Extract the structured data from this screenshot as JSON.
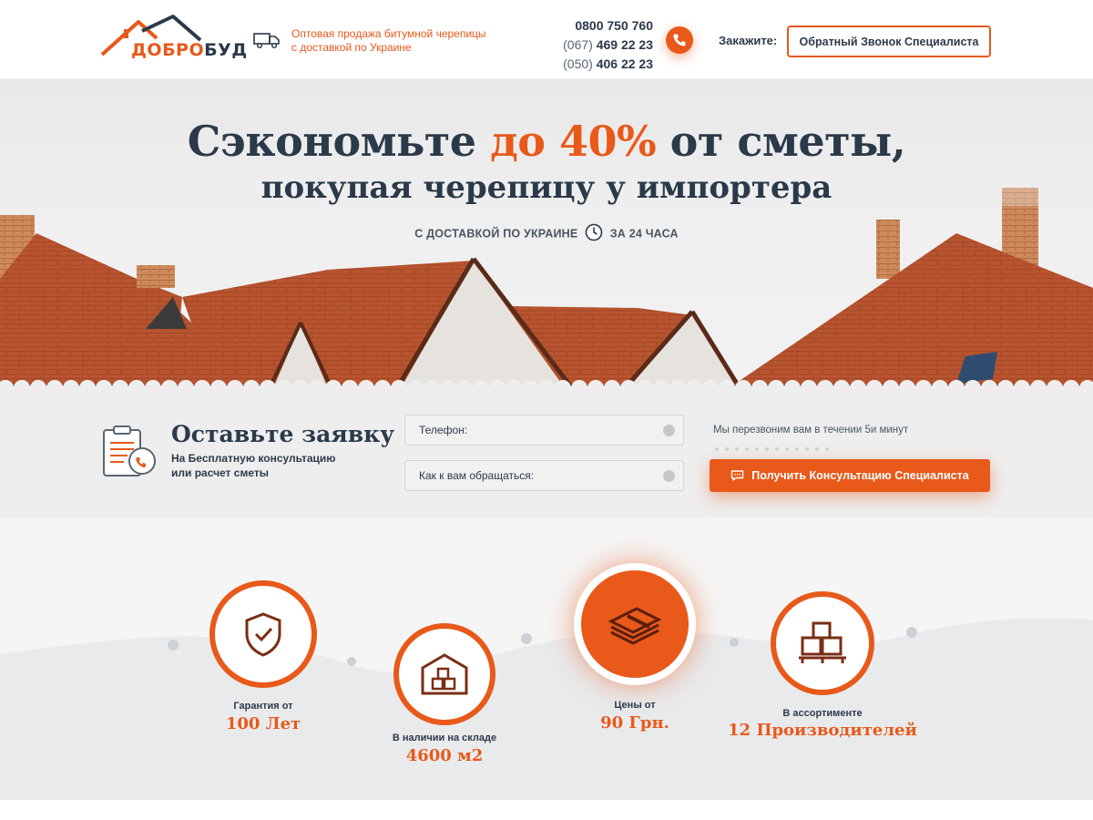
{
  "header": {
    "logo": {
      "part1": "ДОБРО",
      "part2": "БУД"
    },
    "tagline_line1": "Оптовая продажа битумной черепицы",
    "tagline_line2": "с доставкой по Украине",
    "phones": [
      {
        "code": "",
        "number": "0800 750 760"
      },
      {
        "code": "(067)",
        "number": "469 22 23"
      },
      {
        "code": "(050)",
        "number": "406 22 23"
      }
    ],
    "order_label": "Закажите:",
    "callback_button": "Обратный Звонок Специалиста"
  },
  "hero": {
    "title_pre": "Сэкономьте ",
    "title_accent": "до 40%",
    "title_post": " от сметы,",
    "subtitle": "покупая черепицу у импортера",
    "delivery_left": "С ДОСТАВКОЙ ПО УКРАИНЕ",
    "delivery_right": "ЗА 24 ЧАСА"
  },
  "form": {
    "title": "Оставьте заявку",
    "desc_line1": "На Бесплатную консультацию",
    "desc_line2": "или расчет сметы",
    "phone_placeholder": "Телефон:",
    "name_placeholder": "Как к вам обращаться:",
    "callback_note": "Мы перезвоним вам в течении 5и минут",
    "submit_label": "Получить Консультацию Специалиста"
  },
  "features": [
    {
      "label": "Гарантия от",
      "value": "100 Лет",
      "icon": "shield-check-icon"
    },
    {
      "label": "В наличии на складе",
      "value": "4600 м2",
      "icon": "warehouse-icon"
    },
    {
      "label": "Цены от",
      "value": "90 Грн.",
      "icon": "money-stack-icon"
    },
    {
      "label": "В ассортименте",
      "value": "12 Производителей",
      "icon": "boxes-pallet-icon"
    }
  ],
  "colors": {
    "accent": "#e8591a",
    "text": "#2b3a4a",
    "background": "#f5f5f5"
  }
}
